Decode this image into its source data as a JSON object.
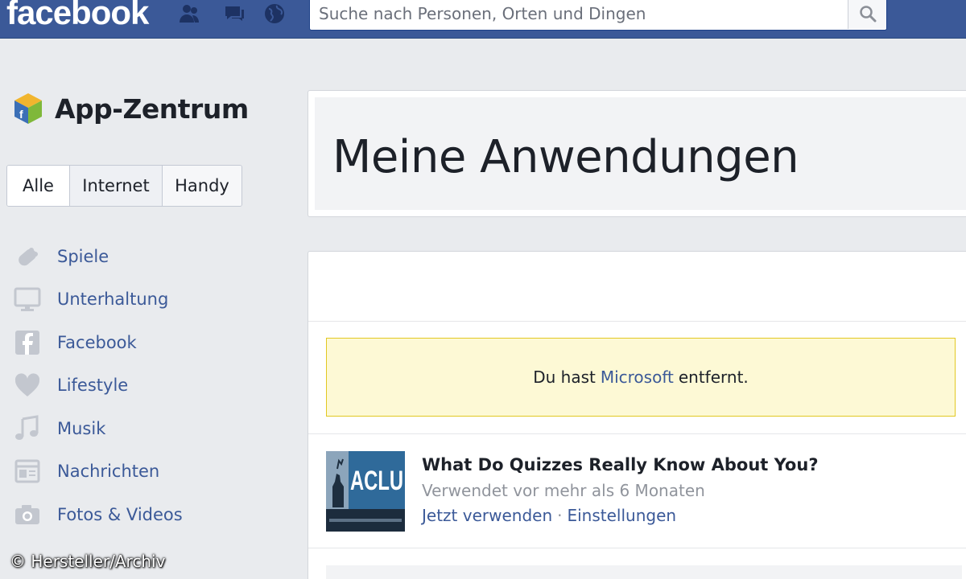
{
  "topbar": {
    "logo": "facebook",
    "search": {
      "placeholder": "Suche nach Personen, Orten und Dingen"
    },
    "jewels": [
      "friends-icon",
      "messages-icon",
      "notifications-globe-icon"
    ],
    "color": "#3b5998"
  },
  "sidebar": {
    "title": "App-Zentrum",
    "filters": [
      {
        "label": "Alle",
        "selected": true
      },
      {
        "label": "Internet",
        "selected": false
      },
      {
        "label": "Handy",
        "selected": false
      }
    ],
    "categories": [
      {
        "label": "Spiele",
        "icon": "gamepad-icon"
      },
      {
        "label": "Unterhaltung",
        "icon": "monitor-icon"
      },
      {
        "label": "Facebook",
        "icon": "facebook-icon"
      },
      {
        "label": "Lifestyle",
        "icon": "heart-icon"
      },
      {
        "label": "Musik",
        "icon": "music-note-icon"
      },
      {
        "label": "Nachrichten",
        "icon": "newspaper-icon"
      },
      {
        "label": "Fotos & Videos",
        "icon": "camera-icon"
      }
    ]
  },
  "main": {
    "title": "Meine Anwendungen",
    "notice": {
      "prefix": "Du hast",
      "link": "Microsoft",
      "suffix": "entfernt."
    },
    "apps": [
      {
        "logo_text": "ACLU",
        "name": "What Do Quizzes Really Know About You?",
        "last_used": "Verwendet vor mehr als 6 Monaten",
        "action_use": "Jetzt verwenden",
        "separator": "·",
        "action_settings": "Einstellungen"
      }
    ]
  },
  "watermark": "© Hersteller/Archiv",
  "colors": {
    "link": "#3b5998",
    "notice_bg": "#fdf9d5",
    "notice_border": "#e2c822"
  }
}
